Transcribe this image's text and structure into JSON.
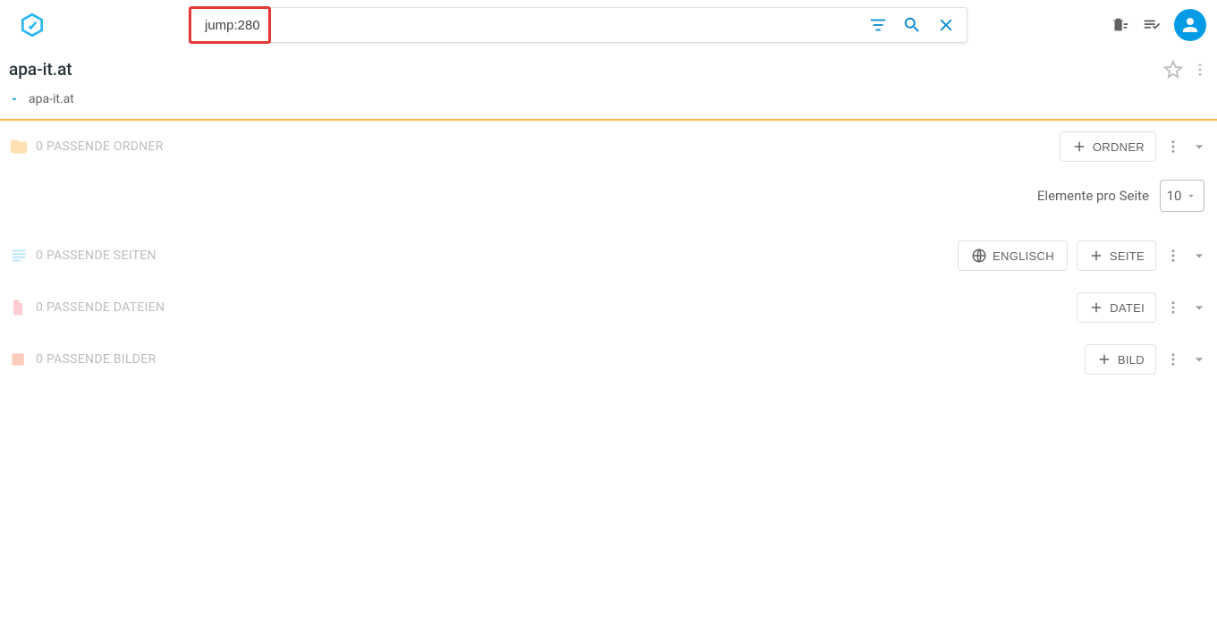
{
  "search": {
    "value": "jump:280",
    "placeholder": ""
  },
  "title": "apa-it.at",
  "breadcrumb": {
    "root": "apa-it.at"
  },
  "sections": {
    "folders": {
      "label": "0 PASSENDE ORDNER",
      "add_label": "ORDNER"
    },
    "pages": {
      "label": "0 PASSENDE SEITEN",
      "lang_label": "ENGLISCH",
      "add_label": "SEITE"
    },
    "files": {
      "label": "0 PASSENDE DATEIEN",
      "add_label": "DATEI"
    },
    "images": {
      "label": "0 PASSENDE BILDER",
      "add_label": "BILD"
    }
  },
  "pager": {
    "label": "Elemente pro Seite",
    "value": "10"
  }
}
